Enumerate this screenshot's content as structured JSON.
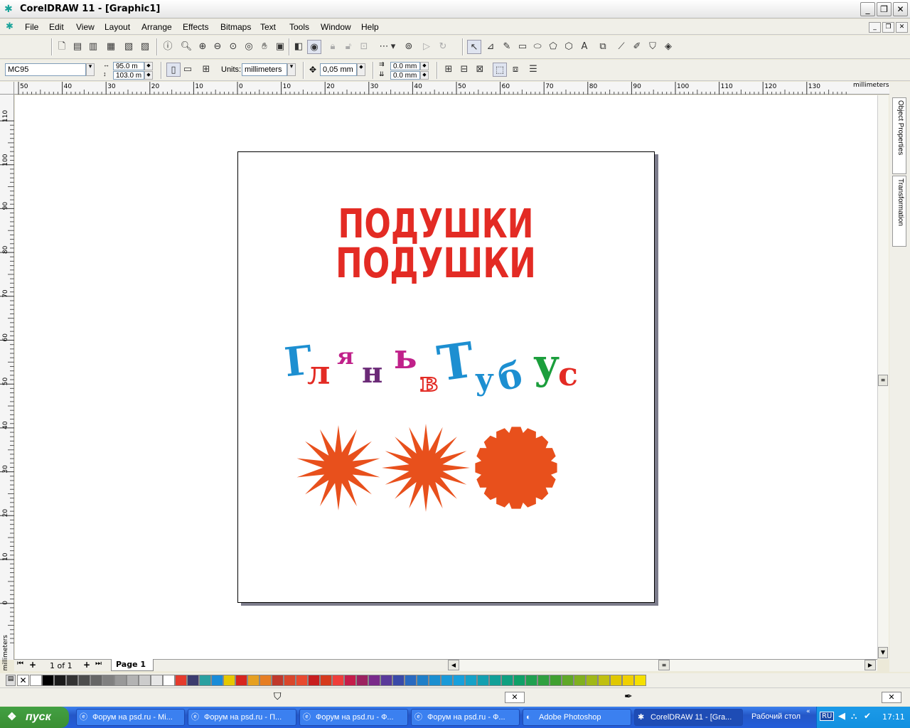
{
  "window": {
    "title": "CorelDRAW 11 - [Graphic1]",
    "min": "_",
    "restore": "❐",
    "close": "✕"
  },
  "menu": [
    "File",
    "Edit",
    "View",
    "Layout",
    "Arrange",
    "Effects",
    "Bitmaps",
    "Text",
    "Tools",
    "Window",
    "Help"
  ],
  "propbar": {
    "preset": "MC95",
    "width": "95.0 m",
    "height": "103.0 m",
    "units_label": "Units:",
    "units": "millimeters",
    "nudge": "0,05 mm",
    "dup_x": "0.0 mm",
    "dup_y": "0.0 mm"
  },
  "rulers": {
    "top_ticks": [
      "50",
      "40",
      "30",
      "20",
      "10",
      "0",
      "10",
      "20",
      "30",
      "40",
      "50",
      "60",
      "70",
      "80",
      "90",
      "100",
      "110",
      "120",
      "130"
    ],
    "top_unit": "millimeters",
    "left_ticks": [
      "110",
      "100",
      "90",
      "80",
      "70",
      "60",
      "50",
      "40",
      "30",
      "20",
      "10",
      "0"
    ],
    "left_unit": "millimeters"
  },
  "artwork": {
    "line1": "ПОДУШКИ",
    "line2": "ПОДУШКИ",
    "letters": [
      "Г",
      "л",
      "я",
      "н",
      "ь",
      "в",
      "Т",
      "у",
      "б",
      "у",
      "с"
    ]
  },
  "sidetabs": [
    "Object Properties",
    "Transformation"
  ],
  "pagenav": {
    "count": "1 of 1",
    "page": "Page 1"
  },
  "palette": [
    "#ffffff",
    "#000000",
    "#1a1a1a",
    "#333333",
    "#4d4d4d",
    "#666666",
    "#808080",
    "#999999",
    "#b3b3b3",
    "#cccccc",
    "#e6e6e6",
    "#ffffff",
    "#e53b2c",
    "#3c3c6e",
    "#2aa0a0",
    "#1a8cd8",
    "#e6c800",
    "#d7261e",
    "#e6a020",
    "#e67e22",
    "#c0392b",
    "#d9472b",
    "#e84a2f",
    "#c81e1e",
    "#d63a1c",
    "#ef3e3a",
    "#c51d4a",
    "#9c2260",
    "#7a2a8a",
    "#5a3a9a",
    "#3a4aa8",
    "#2a6ac0",
    "#1f7fc8",
    "#1b8fd0",
    "#1a9ad8",
    "#18a0dc",
    "#16a2c8",
    "#14a0b0",
    "#12a098",
    "#10a080",
    "#10a068",
    "#20a050",
    "#30a040",
    "#40a030",
    "#60a828",
    "#80b020",
    "#a0b818",
    "#c0c010",
    "#e0c800",
    "#f0d000",
    "#f5e000"
  ],
  "statusbar": {
    "fill_icon": "fill-icon",
    "outline_icon": "outline-icon"
  },
  "taskbar": {
    "start": "пуск",
    "tasks": [
      "Форум на psd.ru - Mi...",
      "Форум на psd.ru - П...",
      "Форум на psd.ru - Ф...",
      "Форум на psd.ru - Ф...",
      "Adobe Photoshop",
      "CorelDRAW 11 - [Gra..."
    ],
    "desktop": "Рабочий стол",
    "lang": "RU",
    "time": "17:11"
  }
}
